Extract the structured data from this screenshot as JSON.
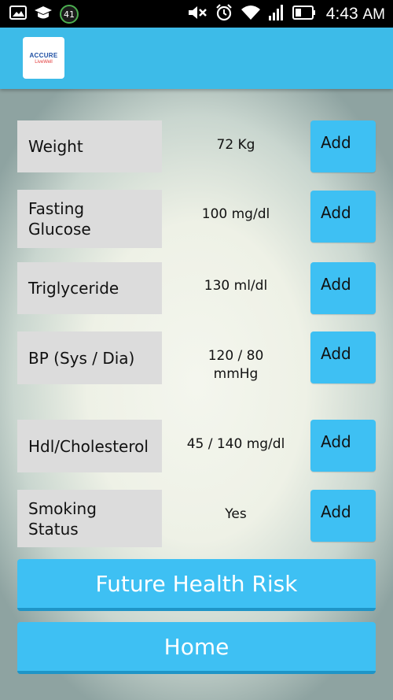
{
  "status_bar": {
    "time": "4:43",
    "ampm": "AM",
    "notification_badge": "41",
    "icons": [
      "image-icon",
      "graduation-cap-icon",
      "mute-icon",
      "alarm-icon",
      "wifi-icon",
      "signal-icon",
      "battery-icon"
    ]
  },
  "app_bar": {
    "logo_text_top": "ACCURE",
    "logo_text_bottom": "LiveWell",
    "color": "#3dbbe8"
  },
  "metrics": [
    {
      "label": "Weight",
      "value": "72 Kg",
      "button": "Add"
    },
    {
      "label": "Fasting Glucose",
      "value": "100 mg/dl",
      "button": "Add"
    },
    {
      "label": "Triglyceride",
      "value": "130 ml/dl",
      "button": "Add"
    },
    {
      "label": "BP (Sys / Dia)",
      "value": "120 / 80 mmHg",
      "button": "Add"
    },
    {
      "label": "Hdl/Cholesterol",
      "value": "45 / 140 mg/dl",
      "button": "Add"
    },
    {
      "label": "Smoking Status",
      "value": "Yes",
      "button": "Add"
    }
  ],
  "buttons": {
    "future_health_risk": "Future Health Risk",
    "home": "Home"
  },
  "colors": {
    "accent": "#3ec0f3",
    "label_bg": "#dcdcdc"
  }
}
